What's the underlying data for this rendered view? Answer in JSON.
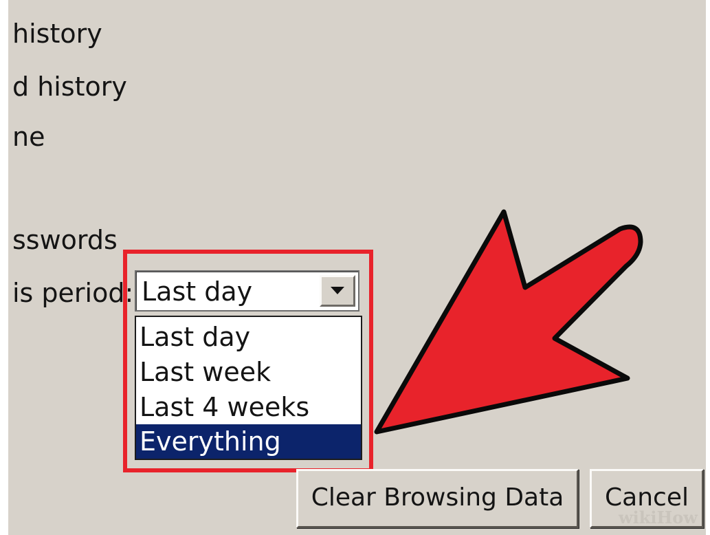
{
  "options_list": {
    "items": [
      {
        "label": "history"
      },
      {
        "label": "d history"
      },
      {
        "label": "ne"
      },
      {
        "label": "sswords"
      }
    ]
  },
  "time_period": {
    "label": "is period:",
    "selected_value": "Last day",
    "options": [
      "Last day",
      "Last week",
      "Last 4 weeks",
      "Everything"
    ],
    "highlighted_option": "Everything"
  },
  "buttons": {
    "clear_label": "Clear Browsing Data",
    "cancel_label": "Cancel"
  },
  "annotation": {
    "highlight_color": "#e8232b",
    "arrow_color": "#e8232b"
  },
  "watermark": {
    "text": "wikiHow"
  },
  "colors": {
    "dialog_background": "#d7d2ca",
    "selection_background": "#0c246b",
    "selection_text": "#ffffff"
  }
}
